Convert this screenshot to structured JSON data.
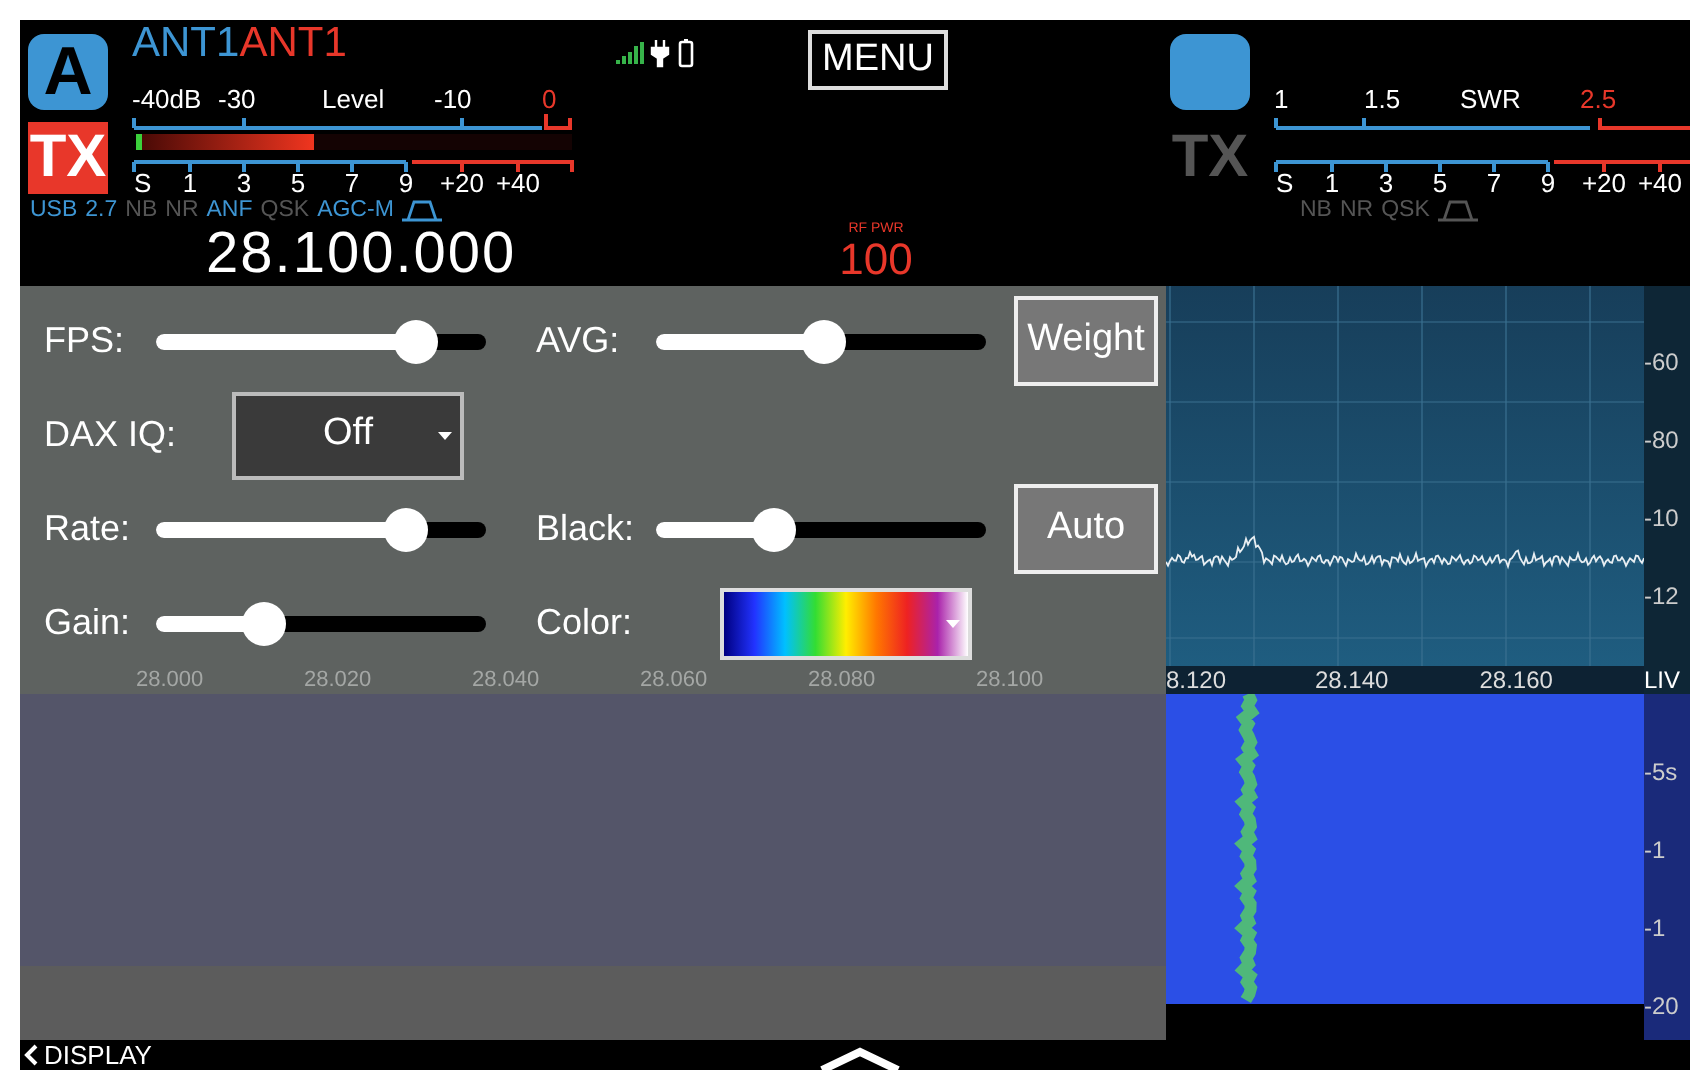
{
  "slices": [
    {
      "letter": "A",
      "rx_antenna": "ANT1",
      "tx_antenna": "ANT1",
      "tx": {
        "label": "TX",
        "active": true
      },
      "meter": {
        "kind": "level",
        "top_labels": [
          {
            "text": "-40dB",
            "over": false
          },
          {
            "text": "-30",
            "over": false
          },
          {
            "text": "Level",
            "over": false
          },
          {
            "text": "-10",
            "over": false
          },
          {
            "text": "0",
            "over": true
          }
        ],
        "level": 0.4,
        "s_labels": [
          "S",
          "1",
          "3",
          "5",
          "7",
          "9",
          "+20",
          "+40"
        ]
      },
      "flags": [
        {
          "kind": "text",
          "text": "USB",
          "on": true
        },
        {
          "kind": "text",
          "text": "2.7",
          "on": true
        },
        {
          "kind": "text",
          "text": "NB",
          "on": false
        },
        {
          "kind": "text",
          "text": "NR",
          "on": false
        },
        {
          "kind": "text",
          "text": "ANF",
          "on": true
        },
        {
          "kind": "text",
          "text": "QSK",
          "on": false
        },
        {
          "kind": "text",
          "text": "AGC-M",
          "on": true
        },
        {
          "kind": "filter",
          "on": true
        }
      ],
      "frequency": "28.100.000"
    },
    {
      "tx": {
        "label": "TX",
        "active": false
      },
      "meter": {
        "kind": "swr",
        "top_labels": [
          {
            "text": "1",
            "over": false
          },
          {
            "text": "1.5",
            "over": false
          },
          {
            "text": "SWR",
            "over": false
          },
          {
            "text": "2.5",
            "over": true
          }
        ],
        "s_labels": [
          "S",
          "1",
          "3",
          "5",
          "7",
          "9",
          "+20",
          "+40"
        ]
      },
      "flags": [
        {
          "kind": "text",
          "text": "NB",
          "on": false
        },
        {
          "kind": "text",
          "text": "NR",
          "on": false
        },
        {
          "kind": "text",
          "text": "QSK",
          "on": false
        },
        {
          "kind": "filter",
          "on": false
        }
      ]
    }
  ],
  "menu_button": "MENU",
  "rf_power": {
    "label": "RF PWR",
    "value": "100"
  },
  "display_panel": {
    "rows": [
      [
        {
          "kind": "slider",
          "label": "FPS:",
          "level": 0.79
        },
        {
          "kind": "slider",
          "label": "AVG:",
          "level": 0.51
        },
        {
          "kind": "button",
          "label": "Weight"
        }
      ],
      [
        {
          "kind": "dropdown",
          "label": "DAX IQ:",
          "value": "Off"
        }
      ],
      [
        {
          "kind": "slider",
          "label": "Rate:",
          "level": 0.76
        },
        {
          "kind": "slider",
          "label": "Black:",
          "level": 0.36
        },
        {
          "kind": "button",
          "label": "Auto"
        }
      ],
      [
        {
          "kind": "slider",
          "label": "Gain:",
          "level": 0.33
        },
        {
          "kind": "color",
          "label": "Color:"
        }
      ]
    ],
    "back_label": "DISPLAY"
  },
  "spectrum": {
    "overlay_freq_labels": [
      "28.000",
      "28.020",
      "28.040",
      "28.060",
      "28.080",
      "28.100"
    ],
    "freq_labels": [
      "8.120",
      "28.140",
      "28.160"
    ],
    "live_label": "LIV",
    "dbm_labels": [
      "-60",
      "-80",
      "-10",
      "-12"
    ],
    "time_labels": [
      "-5s",
      "-1",
      "-1",
      "-20"
    ]
  }
}
